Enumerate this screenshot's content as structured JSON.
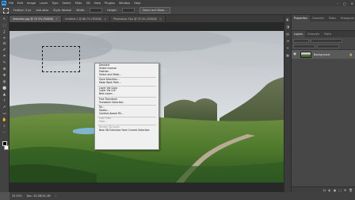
{
  "menubar": {
    "logo": "Ps",
    "items": [
      "File",
      "Edit",
      "Image",
      "Layer",
      "Type",
      "Select",
      "Filter",
      "3D",
      "View",
      "Plugins",
      "Window",
      "Help"
    ],
    "window_controls": [
      "–",
      "▢",
      "✕"
    ]
  },
  "options": {
    "feather_label": "Feather: 0 px",
    "antialias_label": "Anti-alias",
    "style_label": "Style: Normal",
    "width_label": "Width:",
    "height_label": "Height:",
    "select_mask_label": "Select and Mask..."
  },
  "tabs": [
    {
      "label": "Selection.jpg @ 33.3% (RGB/8)",
      "close": "×",
      "active": true
    },
    {
      "label": "Untitled-1 @ 66.7% (RGB/8)",
      "close": "×",
      "active": false
    },
    {
      "label": "Photoshop Tips @ 33.3% (RGB/8)",
      "close": "×",
      "active": false
    }
  ],
  "tools": [
    "↖",
    "⬚",
    "ʆ",
    "⌖",
    "⊡",
    "✐",
    "⌗",
    "✎",
    "⊞",
    "✥",
    "◍",
    "⬤",
    "▲",
    "ᴛ",
    "↗",
    "▭",
    "✋",
    "⌕",
    "⋯"
  ],
  "context_menu": {
    "items": [
      {
        "label": "Deselect",
        "disabled": false
      },
      {
        "label": "Select Inverse",
        "disabled": false
      },
      {
        "label": "Feather...",
        "disabled": false
      },
      {
        "label": "Select and Mask...",
        "disabled": false
      },
      {
        "sep": true
      },
      {
        "label": "Save Selection...",
        "disabled": false
      },
      {
        "label": "Make Work Path...",
        "disabled": false
      },
      {
        "sep": true
      },
      {
        "label": "Layer Via Copy",
        "disabled": false
      },
      {
        "label": "Layer Via Cut",
        "disabled": false
      },
      {
        "label": "New Layer...",
        "disabled": false
      },
      {
        "sep": true
      },
      {
        "label": "Free Transform",
        "disabled": false
      },
      {
        "label": "Transform Selection",
        "disabled": false
      },
      {
        "sep": true
      },
      {
        "label": "Fill...",
        "disabled": false
      },
      {
        "label": "Stroke...",
        "disabled": false
      },
      {
        "label": "Content-Aware Fill...",
        "disabled": false
      },
      {
        "sep": true
      },
      {
        "label": "Last Filter",
        "disabled": true
      },
      {
        "label": "Fade...",
        "disabled": true
      },
      {
        "sep": true
      },
      {
        "label": "Render 3D Layer",
        "disabled": true
      },
      {
        "label": "New 3D Extrusion from Current Selection",
        "disabled": false
      }
    ]
  },
  "panels": {
    "top_tabs": [
      "Properties",
      "Channels",
      "Paths",
      "Histogram"
    ],
    "layer_tabs": [
      "Layers",
      "Channels",
      "Paths"
    ],
    "layer_name": "Background",
    "eye": "◉",
    "lock": "🔒",
    "footer_icons": [
      "ƒx",
      "◐",
      "▣",
      "▢",
      "⊕",
      "🗑"
    ]
  },
  "dock_icons": [
    "◧",
    "◨",
    "▤",
    "◔",
    "✦",
    "▦"
  ],
  "status": {
    "zoom": "33.33%",
    "doc_info": "Doc: 34.3M/34.3M",
    "arrow": "›"
  }
}
